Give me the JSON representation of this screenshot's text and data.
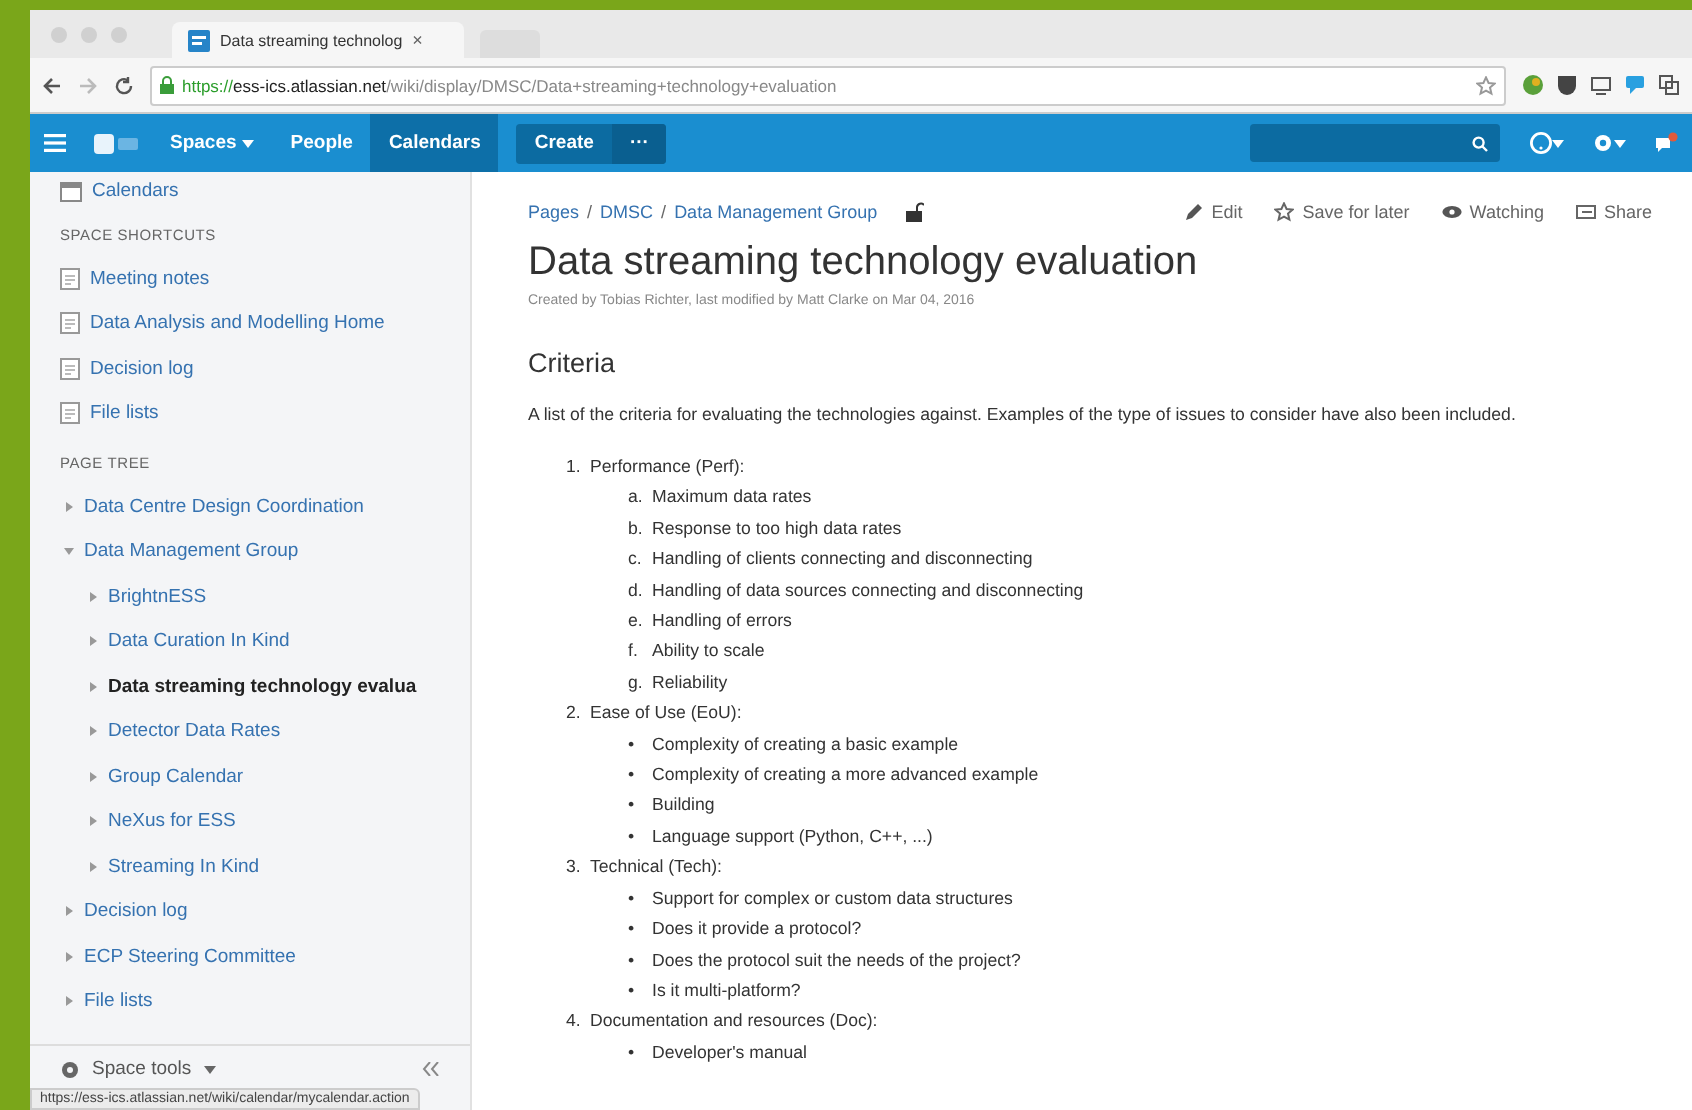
{
  "browser": {
    "tab_title": "Data streaming technolog",
    "tab_close": "×",
    "url_scheme": "https://",
    "url_host": "ess-ics.atlassian.net",
    "url_path": "/wiki/display/DMSC/Data+streaming+technology+evaluation"
  },
  "nav": {
    "items": [
      {
        "label": "Spaces",
        "kind": "dropdown",
        "selected": false
      },
      {
        "label": "People",
        "kind": "link",
        "selected": false
      },
      {
        "label": "Calendars",
        "kind": "link",
        "selected": true
      }
    ],
    "create": "Create",
    "more": "···"
  },
  "sidebar": {
    "top_item": "Calendars",
    "shortcuts_heading": "SPACE SHORTCUTS",
    "shortcuts": [
      "Meeting notes",
      "Data Analysis and Modelling Home",
      "Decision log",
      "File lists"
    ],
    "tree_heading": "PAGE TREE",
    "tree": [
      {
        "label": "Data Centre Design Coordination",
        "expanded": false,
        "selected": false
      },
      {
        "label": "Data Management Group",
        "expanded": true,
        "selected": false,
        "children": [
          {
            "label": "BrightnESS",
            "expanded": false,
            "selected": false
          },
          {
            "label": "Data Curation In Kind",
            "expanded": false,
            "selected": false
          },
          {
            "label": "Data streaming technology evalua",
            "expanded": false,
            "selected": true
          },
          {
            "label": "Detector Data Rates",
            "expanded": false,
            "selected": false
          },
          {
            "label": "Group Calendar",
            "expanded": false,
            "selected": false
          },
          {
            "label": "NeXus for ESS",
            "expanded": false,
            "selected": false
          },
          {
            "label": "Streaming In Kind",
            "expanded": false,
            "selected": false
          }
        ]
      },
      {
        "label": "Decision log",
        "expanded": false,
        "selected": false
      },
      {
        "label": "ECP Steering Committee",
        "expanded": false,
        "selected": false
      },
      {
        "label": "File lists",
        "expanded": false,
        "selected": false
      }
    ],
    "space_tools": "Space tools"
  },
  "breadcrumbs": [
    "Pages",
    "DMSC",
    "Data Management Group"
  ],
  "breadcrumb_separators": [
    "/",
    "/"
  ],
  "actions": [
    {
      "label": "Edit",
      "kind": "edit"
    },
    {
      "label": "Save for later",
      "kind": "save"
    },
    {
      "label": "Watching",
      "kind": "watch"
    },
    {
      "label": "Share",
      "kind": "share"
    }
  ],
  "title": "Data streaming technology evaluation",
  "byline": "Created by Tobias Richter, last modified by Matt Clarke on Mar 04, 2016",
  "section_heading": "Criteria",
  "intro": "A list of the criteria for evaluating the technologies against.  Examples of the type of issues to consider have also been included.",
  "criteria": [
    {
      "marker": "1.",
      "label": "Performance (Perf):",
      "items": [
        {
          "marker": "a.",
          "label": "Maximum data rates"
        },
        {
          "marker": "b.",
          "label": "Response to too high data rates"
        },
        {
          "marker": "c.",
          "label": "Handling of clients connecting and disconnecting"
        },
        {
          "marker": "d.",
          "label": "Handling of data sources connecting and disconnecting"
        },
        {
          "marker": "e.",
          "label": "Handling of errors"
        },
        {
          "marker": "f.",
          "label": "Ability to scale"
        },
        {
          "marker": "g.",
          "label": "Reliability"
        }
      ]
    },
    {
      "marker": "2.",
      "label": "Ease of Use (EoU):",
      "items": [
        {
          "marker": "•",
          "label": "Complexity of creating a basic example"
        },
        {
          "marker": "•",
          "label": "Complexity of creating a more advanced example"
        },
        {
          "marker": "•",
          "label": "Building"
        },
        {
          "marker": "•",
          "label": "Language support (Python, C++, ...)"
        }
      ]
    },
    {
      "marker": "3.",
      "label": "Technical (Tech):",
      "items": [
        {
          "marker": "•",
          "label": "Support for complex or custom data structures"
        },
        {
          "marker": "•",
          "label": "Does it provide a protocol?"
        },
        {
          "marker": "•",
          "label": "Does the protocol suit the needs of the project?"
        },
        {
          "marker": "•",
          "label": "Is it multi-platform?"
        }
      ]
    },
    {
      "marker": "4.",
      "label": "Documentation and resources (Doc):",
      "items": [
        {
          "marker": "•",
          "label": "Developer's manual"
        }
      ]
    }
  ],
  "status_bar": "https://ess-ics.atlassian.net/wiki/calendar/mycalendar.action"
}
